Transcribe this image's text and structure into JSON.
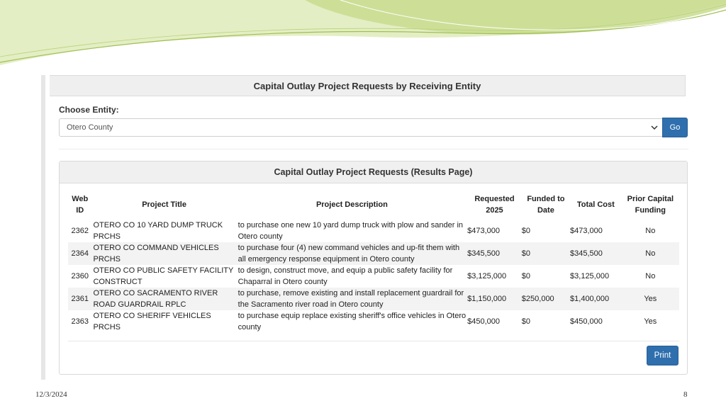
{
  "colors": {
    "accent_button": "#2f6fae",
    "swoosh_light": "#e4eec4",
    "swoosh_mid": "#c5da8a",
    "panel_heading_bg": "#efefef",
    "row_stripe": "#f3f3f3"
  },
  "page": {
    "heading": "Capital Outlay Project Requests by Receiving Entity",
    "choose_label": "Choose Entity:",
    "entity_selected": "Otero County",
    "go_label": "Go",
    "chevron_icon": "chevron-down-icon"
  },
  "results": {
    "heading": "Capital Outlay Project Requests (Results Page)",
    "columns": {
      "web_id": "Web ID",
      "title": "Project Title",
      "description": "Project Description",
      "requested": "Requested 2025",
      "funded": "Funded to Date",
      "total": "Total Cost",
      "prior": "Prior Capital Funding"
    },
    "rows": [
      {
        "id": "2362",
        "title": "OTERO CO 10 YARD DUMP TRUCK PRCHS",
        "description": "to purchase one new 10 yard dump truck with plow and sander in Otero county",
        "requested": "$473,000",
        "funded": "$0",
        "total": "$473,000",
        "prior": "No"
      },
      {
        "id": "2364",
        "title": "OTERO CO COMMAND VEHICLES PRCHS",
        "description": "to purchase four (4) new command vehicles and up-fit them with all emergency response equipment in Otero county",
        "requested": "$345,500",
        "funded": "$0",
        "total": "$345,500",
        "prior": "No"
      },
      {
        "id": "2360",
        "title": "OTERO CO PUBLIC SAFETY FACILITY CONSTRUCT",
        "description": "to design, construct move, and equip a public safety facility for Chaparral in Otero county",
        "requested": "$3,125,000",
        "funded": "$0",
        "total": "$3,125,000",
        "prior": "No"
      },
      {
        "id": "2361",
        "title": "OTERO CO SACRAMENTO RIVER ROAD GUARDRAIL RPLC",
        "description": "to purchase, remove existing and install replacement guardrail for the Sacramento river road in Otero county",
        "requested": "$1,150,000",
        "funded": "$250,000",
        "total": "$1,400,000",
        "prior": "Yes"
      },
      {
        "id": "2363",
        "title": "OTERO CO SHERIFF VEHICLES PRCHS",
        "description": "to purchase equip replace existing sheriff's office vehicles in Otero county",
        "requested": "$450,000",
        "funded": "$0",
        "total": "$450,000",
        "prior": "Yes"
      }
    ],
    "print_label": "Print"
  },
  "slide": {
    "date": "12/3/2024",
    "number": "8"
  }
}
